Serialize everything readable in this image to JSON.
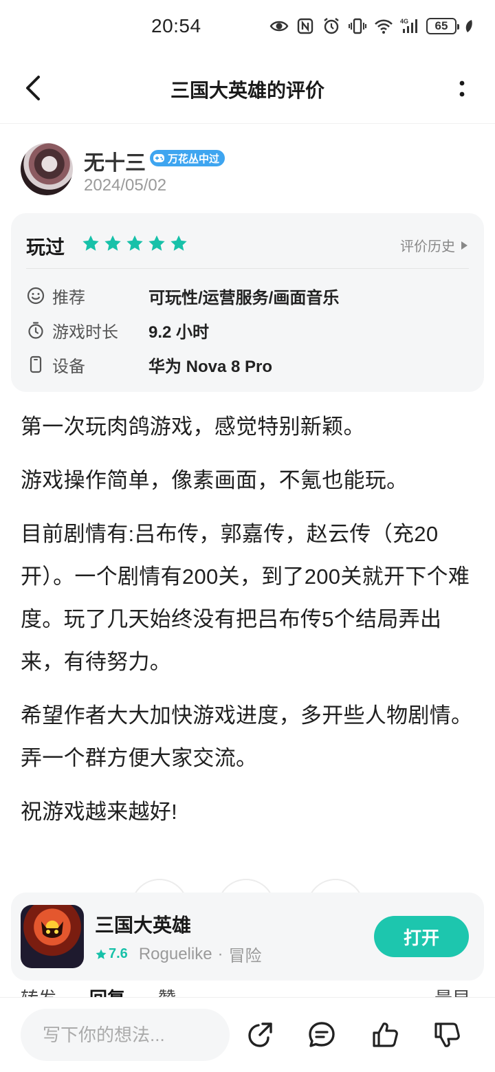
{
  "status_bar": {
    "time": "20:54",
    "battery": "65",
    "icons": [
      "eye-icon",
      "nfc-icon",
      "alarm-icon",
      "vibrate-icon",
      "wifi-icon",
      "signal-4g-icon",
      "battery-icon",
      "leaf-icon"
    ]
  },
  "header": {
    "title": "三国大英雄的评价"
  },
  "user": {
    "name": "无十三",
    "badge": "万花丛中过",
    "date": "2024/05/02"
  },
  "review_card": {
    "status": "玩过",
    "rating": 5,
    "history_label": "评价历史",
    "details": [
      {
        "icon": "smile-icon",
        "label": "推荐",
        "value": "可玩性/运营服务/画面音乐"
      },
      {
        "icon": "timer-icon",
        "label": "游戏时长",
        "value": "9.2 小时"
      },
      {
        "icon": "phone-icon",
        "label": "设备",
        "value": "华为 Nova 8 Pro"
      }
    ]
  },
  "review_text": [
    "第一次玩肉鸽游戏，感觉特别新颖。",
    "游戏操作简单，像素画面，不氪也能玩。",
    "目前剧情有:吕布传，郭嘉传，赵云传（充20开）。一个剧情有200关，到了200关就开下个难度。玩了几天始终没有把吕布传5个结局弄出来，有待努力。",
    "希望作者大大加快游戏进度，多开些人物剧情。弄一个群方便大家交流。",
    "祝游戏越来越好!"
  ],
  "game": {
    "name": "三国大英雄",
    "rating": "7.6",
    "tag1": "Roguelike",
    "separator": "·",
    "tag2": "冒险",
    "open_label": "打开"
  },
  "tabs_peek": [
    "转发",
    "回复",
    "赞",
    "最早"
  ],
  "bottom_bar": {
    "comment_placeholder": "写下你的想法..."
  },
  "colors": {
    "accent": "#1dc6ae",
    "star": "#17c1a9",
    "badge": "#3ea5f0"
  }
}
